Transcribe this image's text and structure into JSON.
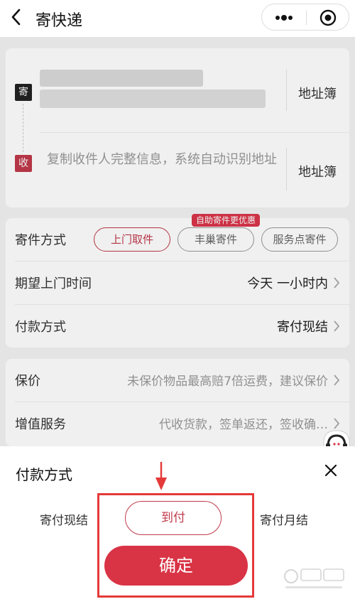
{
  "header": {
    "title": "寄快递"
  },
  "address": {
    "send_tag": "寄",
    "recv_tag": "收",
    "address_book": "地址簿",
    "recv_placeholder": "复制收件人完整信息，系统自动识别地址"
  },
  "shipping": {
    "method_label": "寄件方式",
    "options": [
      "上门取件",
      "丰巢寄件",
      "服务点寄件"
    ],
    "promo_badge": "自助寄件更优惠",
    "pickup_label": "期望上门时间",
    "pickup_value": "今天 一小时内",
    "payment_label": "付款方式",
    "payment_value": "寄付现结"
  },
  "extra": {
    "insure_label": "保价",
    "insure_value": "未保价物品最高赔7倍运费，建议保价",
    "service_label": "增值服务",
    "service_value": "代收货款，签单返还，签收确…"
  },
  "sheet": {
    "title": "付款方式",
    "options": [
      "寄付现结",
      "到付",
      "寄付月结"
    ],
    "confirm": "确定"
  },
  "colors": {
    "accent": "#d93446",
    "highlight": "#e53a3a"
  }
}
